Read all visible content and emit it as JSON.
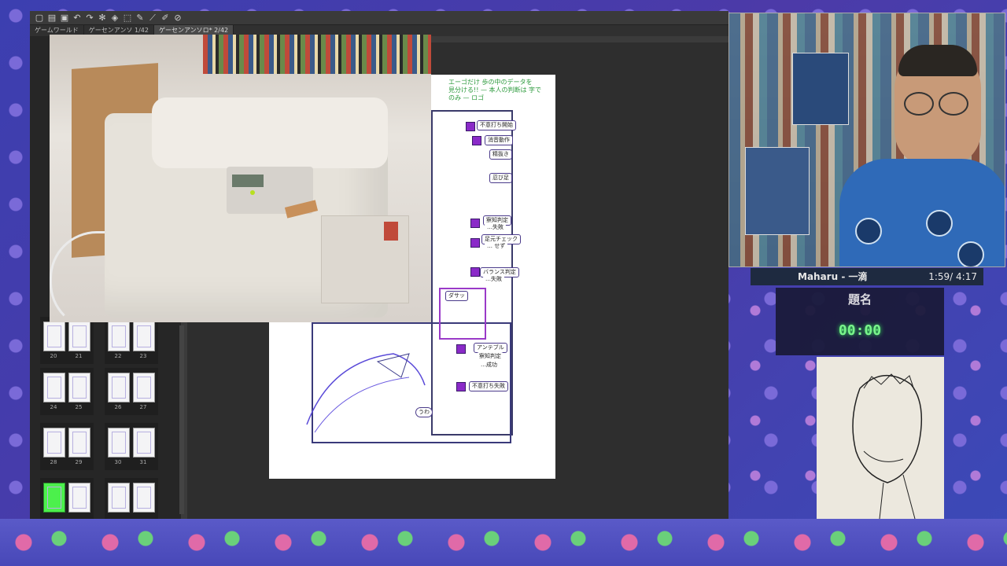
{
  "app": {
    "tabs": [
      {
        "label": "ゲームワールド"
      },
      {
        "label": "ゲーセンアンソ 1/42"
      },
      {
        "label": "ゲーセンアンソロ* 2/42"
      }
    ],
    "toolbar_icons": [
      "new-icon",
      "open-icon",
      "save-icon",
      "undo-icon",
      "redo-icon",
      "gear-icon",
      "transform-icon",
      "select-icon",
      "pen-icon",
      "ruler-icon",
      "pencil-icon",
      "brush-icon"
    ]
  },
  "thumbnails": {
    "pages": [
      "20",
      "21",
      "22",
      "23",
      "24",
      "25",
      "26",
      "27",
      "28",
      "29",
      "30",
      "31"
    ]
  },
  "manga": {
    "note_line1": "エーゴだけ 歩の中のデータを",
    "note_line2": "見分ける!! — 本人の判断は 字で",
    "note_line3": "のみ — ロゴ",
    "boxes": [
      {
        "text": "不意打ち開始"
      },
      {
        "text": "消音動作"
      },
      {
        "text": "精抜き"
      },
      {
        "text": "忍び足"
      },
      {
        "text": "察知判定"
      },
      {
        "text": "…失敗"
      },
      {
        "text": "足元チェック"
      },
      {
        "text": "… せず"
      },
      {
        "text": "バランス判定"
      },
      {
        "text": "…失敗"
      },
      {
        "text": "ダサッ"
      },
      {
        "text": "アンテブル"
      },
      {
        "text": "察知判定"
      },
      {
        "text": "…成功"
      },
      {
        "text": "不意打ち失敗"
      },
      {
        "text": "うわ"
      }
    ]
  },
  "now_playing": {
    "title": "Maharu - 一滴",
    "time": "1:59/ 4:17"
  },
  "theme": {
    "label": "題名",
    "timer": "00:00"
  },
  "colors": {
    "accent_green": "#7cff8a",
    "sketch_purple": "#8a2ac8",
    "note_green": "#2c9a3c"
  }
}
